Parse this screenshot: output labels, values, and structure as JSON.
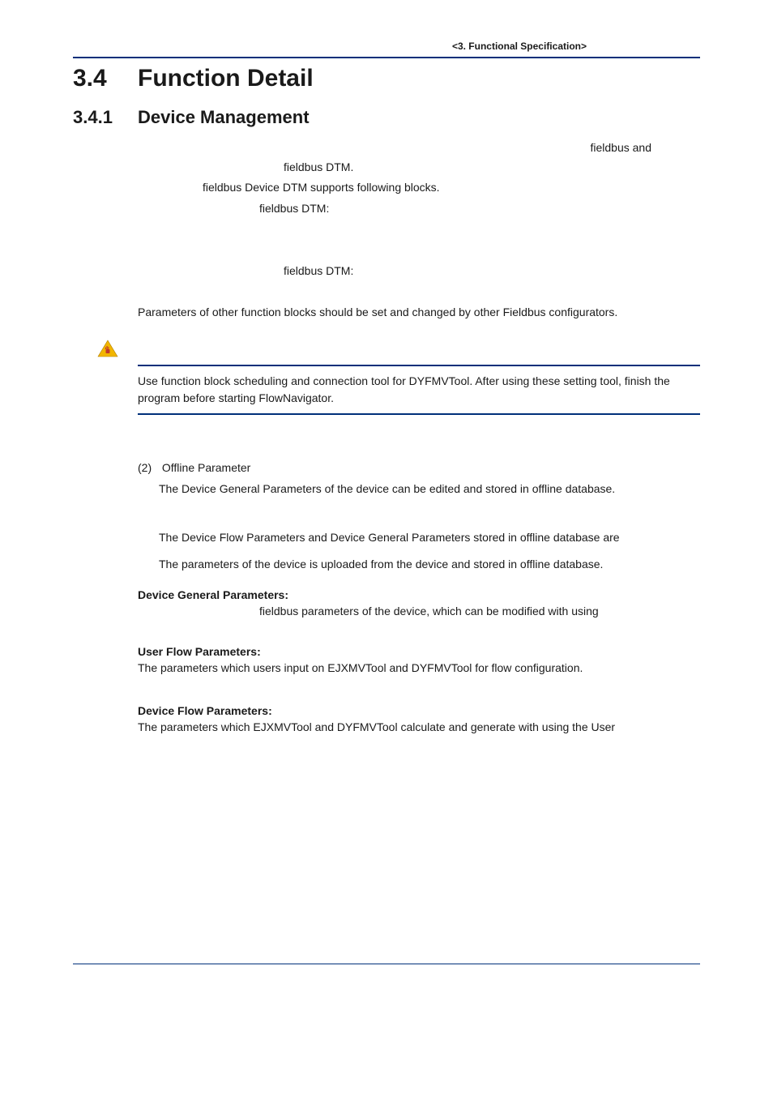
{
  "header": {
    "breadcrumb": "<3.  Functional Specification>"
  },
  "h1": {
    "num": "3.4",
    "title": "Function Detail"
  },
  "h2": {
    "num": "3.4.1",
    "title": "Device Management"
  },
  "intro": {
    "l1a": "fieldbus and",
    "l1b": "fieldbus DTM.",
    "l2": "fieldbus Device DTM supports following blocks.",
    "l3": "fieldbus DTM:",
    "l4": "fieldbus DTM:",
    "l5": "Parameters of other function blocks should be set and changed by other Fieldbus configurators."
  },
  "important": {
    "text": "Use function block scheduling and connection tool for DYFMVTool. After using these setting tool, finish the program before starting FlowNavigator."
  },
  "sub2": {
    "num": "(2)",
    "title": "Offline Parameter",
    "body1": "The Device General Parameters of the device can be edited and stored in offline database.",
    "body2": "The Device Flow Parameters and Device General Parameters stored in offline database are",
    "body3": "The parameters of the device is uploaded from the device and stored in offline database."
  },
  "dgp": {
    "label": "Device General Parameters:",
    "body": "fieldbus parameters of the device, which can be modified with using"
  },
  "ufp": {
    "label": "User Flow Parameters:",
    "body": "The parameters which users input on EJXMVTool and DYFMVTool for flow configuration."
  },
  "dfp": {
    "label": "Device Flow Parameters:",
    "body": "The parameters which EJXMVTool and DYFMVTool calculate and generate with using the User"
  }
}
